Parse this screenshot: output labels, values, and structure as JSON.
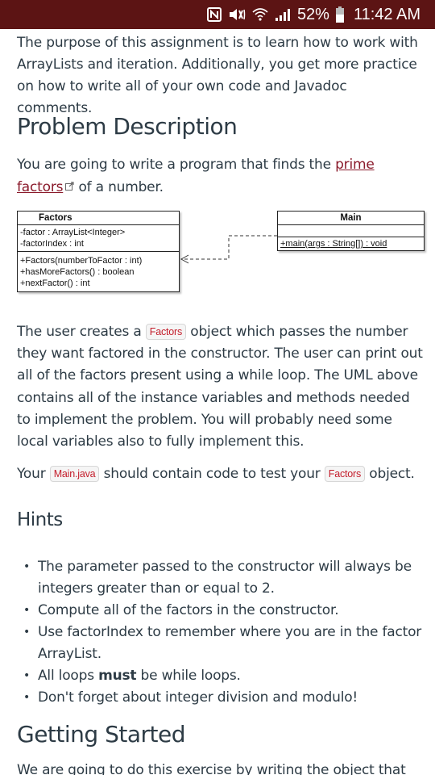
{
  "status_bar": {
    "icons": [
      "nfc-icon",
      "vibrate-mute-icon",
      "wifi-icon",
      "signal-icon"
    ],
    "battery_percent": "52%",
    "time": "11:42 AM",
    "background_color": "#5c1414"
  },
  "intro": {
    "text": "The purpose of this assignment is to learn how to work with ArrayLists and iteration. Additionally, you get more practice on how to write all of your own code and Javadoc comments."
  },
  "problem": {
    "heading": "Problem Description",
    "text_before_link": "You are going to write a program that finds the ",
    "link_text": "prime factors",
    "text_after_link": " of a number.",
    "link_color": "#8a1a2b"
  },
  "uml": {
    "factors": {
      "name": "Factors",
      "attributes": [
        "-factor : ArrayList<Integer>",
        "-factorIndex : int"
      ],
      "operations": [
        "+Factors(numberToFactor : int)",
        "+hasMoreFactors() : boolean",
        "+nextFactor() : int"
      ]
    },
    "main": {
      "name": "Main",
      "attributes": [],
      "operations": [
        "+main(args : String[]) : void"
      ]
    },
    "relationship": "dependency: Main uses Factors"
  },
  "user_paragraph": {
    "t1": "The user creates a ",
    "code1": "Factors",
    "t2": " object which passes the number they want factored in the constructor. The user can print out all of the factors present using a while loop. The UML above contains all of the instance variables and methods needed to implement the problem. You will probably need some local variables also to fully implement this."
  },
  "main_paragraph": {
    "t1": "Your ",
    "code1": "Main.java",
    "t2": " should contain code to test your ",
    "code2": "Factors",
    "t3": " object."
  },
  "hints": {
    "heading": "Hints",
    "items": [
      {
        "text": "The parameter passed to the constructor will always be integers greater than or equal to 2."
      },
      {
        "text": "Compute all of the factors in the constructor."
      },
      {
        "text": "Use factorIndex to remember where you are in the factor ArrayList."
      },
      {
        "pre": "All loops ",
        "bold": "must",
        "post": " be while loops."
      },
      {
        "text": "Don't forget about integer division and modulo!"
      }
    ]
  },
  "getting_started": {
    "heading": "Getting Started",
    "text": "We are going to do this exercise by writing the object that"
  }
}
